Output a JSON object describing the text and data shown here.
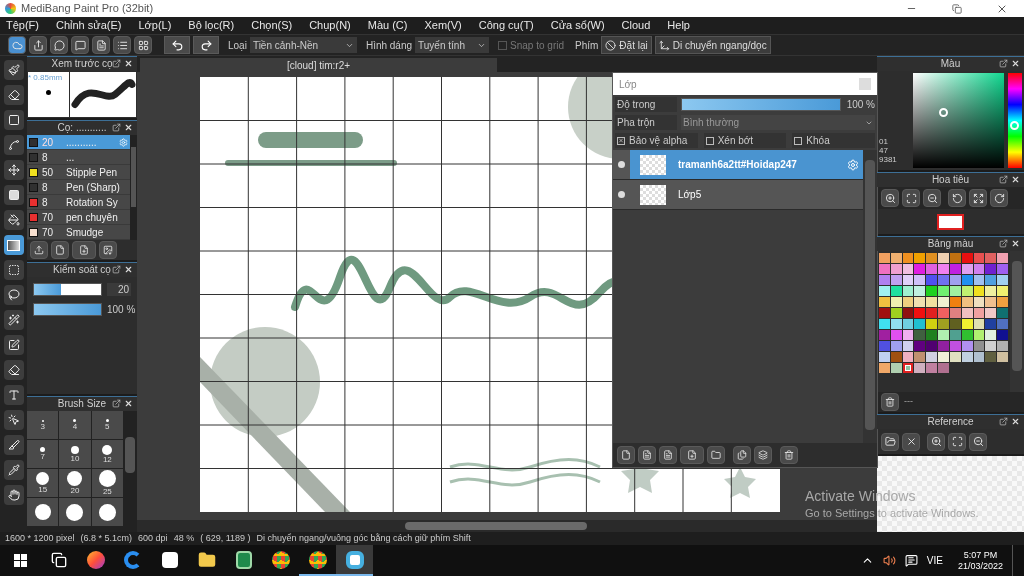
{
  "window": {
    "title": "MediBang Paint Pro (32bit)"
  },
  "menu": [
    "Tệp(F)",
    "Chỉnh sửa(E)",
    "Lớp(L)",
    "Bộ lọc(R)",
    "Chọn(S)",
    "Chụp(N)",
    "Màu (C)",
    "Xem(V)",
    "Công cụ(T)",
    "Cửa sổ(W)",
    "Cloud",
    "Help"
  ],
  "toolbar": {
    "buttons": [
      {
        "kind": "cloud",
        "selected": true
      },
      {
        "kind": "share",
        "selected": false
      },
      {
        "kind": "bubble",
        "selected": false
      },
      {
        "kind": "comment",
        "selected": false
      },
      {
        "kind": "page",
        "selected": false
      },
      {
        "kind": "list",
        "selected": false
      },
      {
        "kind": "grid",
        "selected": false
      }
    ],
    "type_label": "Loại",
    "type_value": "Tiền cảnh-Nền",
    "shape_label": "Hình dáng",
    "shape_value": "Tuyến tính",
    "snap": {
      "label": "Snap to grid",
      "checked": false,
      "disabled": true
    },
    "key_label": "Phím",
    "reset": "Đặt lại",
    "move": "Di chuyển ngang/dọc"
  },
  "tools": [
    {
      "kind": "brush",
      "selected": false
    },
    {
      "kind": "eraser",
      "selected": false
    },
    {
      "kind": "rect",
      "selected": false
    },
    {
      "kind": "polyline",
      "selected": false
    },
    {
      "kind": "move",
      "selected": false
    },
    {
      "kind": "fill-rect",
      "selected": false
    },
    {
      "kind": "bucket",
      "selected": false
    },
    {
      "kind": "gradient",
      "selected": true
    },
    {
      "kind": "select",
      "selected": false
    },
    {
      "kind": "lasso",
      "selected": false
    },
    {
      "kind": "wand",
      "selected": false
    },
    {
      "kind": "select-pen",
      "selected": false
    },
    {
      "kind": "select-eraser",
      "selected": false
    },
    {
      "kind": "text",
      "selected": false
    },
    {
      "kind": "operation",
      "selected": false
    },
    {
      "kind": "divide",
      "selected": false
    },
    {
      "kind": "eyedropper",
      "selected": false
    },
    {
      "kind": "hand",
      "selected": false
    }
  ],
  "brush_preview": {
    "title": "Xem trước cọ",
    "size": "* 0.85mm"
  },
  "brushes": {
    "title": "Cọ: ...........",
    "items": [
      {
        "size": "20",
        "name": "...........",
        "color": "#303030",
        "selected": true
      },
      {
        "size": "8",
        "name": "...",
        "color": "#303030",
        "selected": false
      },
      {
        "size": "50",
        "name": "Stipple Pen",
        "color": "#f0e020",
        "selected": false
      },
      {
        "size": "8",
        "name": "Pen (Sharp)",
        "color": "#303030",
        "selected": false
      },
      {
        "size": "8",
        "name": "Rotation Sy",
        "color": "#e83030",
        "selected": false
      },
      {
        "size": "70",
        "name": "pen chuyên",
        "color": "#e83030",
        "selected": false
      },
      {
        "size": "70",
        "name": "Smudge",
        "color": "#f8e0d0",
        "selected": false
      }
    ]
  },
  "brush_control": {
    "title": "Kiểm soát cọ",
    "size": {
      "level": 0.4,
      "reading": "20"
    },
    "opacity": {
      "level": 1,
      "reading": "100 %"
    }
  },
  "brush_size": {
    "title": "Brush Size",
    "items": [
      {
        "kind": "labeled",
        "label": "3"
      },
      {
        "kind": "labeled",
        "label": "4"
      },
      {
        "kind": "labeled",
        "label": "5"
      },
      {
        "kind": "labeled",
        "label": "7"
      },
      {
        "kind": "labeled",
        "label": "10"
      },
      {
        "kind": "labeled",
        "label": "12"
      },
      {
        "kind": "labeled",
        "label": "15"
      },
      {
        "kind": "labeled",
        "label": "20"
      },
      {
        "kind": "labeled",
        "label": "25"
      },
      {
        "kind": "unlabeled"
      },
      {
        "kind": "unlabeled"
      },
      {
        "kind": "unlabeled"
      }
    ]
  },
  "canvas": {
    "tab": "[cloud] tim:r2+"
  },
  "layers": {
    "title": "Lớp",
    "opacity_label": "Độ trong",
    "opacity": {
      "level": 1,
      "reading": "100 %"
    },
    "blend_label": "Pha trộn",
    "blend_value": "Bình thường",
    "options": [
      {
        "label": "Bảo vệ alpha",
        "checked": true
      },
      {
        "label": "Xén bớt",
        "checked": false
      },
      {
        "label": "Khóa",
        "checked": false
      }
    ],
    "items": [
      {
        "name": "tramanh6a2tt#Hoidap247",
        "selected": true
      },
      {
        "name": "Lớp5",
        "selected": false
      }
    ]
  },
  "color_panel": {
    "title": "Màu",
    "values": [
      "01",
      "47",
      "9381"
    ]
  },
  "navigator": {
    "title": "Hoa tiêu"
  },
  "palette": {
    "title": "Bảng màu",
    "footer": "---",
    "swatches": [
      {
        "color": "#f0a060",
        "selected": false
      },
      {
        "color": "#f0b070",
        "selected": false
      },
      {
        "color": "#f09020",
        "selected": false
      },
      {
        "color": "#f0a000",
        "selected": false
      },
      {
        "color": "#e09020",
        "selected": false
      },
      {
        "color": "#f0d0b0",
        "selected": false
      },
      {
        "color": "#c07010",
        "selected": false
      },
      {
        "color": "#e81010",
        "selected": false
      },
      {
        "color": "#e85050",
        "selected": false
      },
      {
        "color": "#e06060",
        "selected": false
      },
      {
        "color": "#f0a0b0",
        "selected": false
      },
      {
        "color": "#f070c0",
        "selected": false
      },
      {
        "color": "#f0a0d0",
        "selected": false
      },
      {
        "color": "#f0c0e0",
        "selected": false
      },
      {
        "color": "#e020e0",
        "selected": false
      },
      {
        "color": "#e060e0",
        "selected": false
      },
      {
        "color": "#f080f0",
        "selected": false
      },
      {
        "color": "#c020e0",
        "selected": false
      },
      {
        "color": "#e0a0f0",
        "selected": false
      },
      {
        "color": "#d080f0",
        "selected": false
      },
      {
        "color": "#7020d0",
        "selected": false
      },
      {
        "color": "#a060f0",
        "selected": false
      },
      {
        "color": "#b080f0",
        "selected": false
      },
      {
        "color": "#c0a0f0",
        "selected": false
      },
      {
        "color": "#e0d0f8",
        "selected": false
      },
      {
        "color": "#d0c0f8",
        "selected": false
      },
      {
        "color": "#5050f0",
        "selected": false
      },
      {
        "color": "#7070f0",
        "selected": false
      },
      {
        "color": "#a0a0f0",
        "selected": false
      },
      {
        "color": "#2090f0",
        "selected": false
      },
      {
        "color": "#a0c0f0",
        "selected": false
      },
      {
        "color": "#50a0e0",
        "selected": false
      },
      {
        "color": "#a0d0f0",
        "selected": false
      },
      {
        "color": "#a0f0f0",
        "selected": false
      },
      {
        "color": "#20e0a0",
        "selected": false
      },
      {
        "color": "#a0f0d0",
        "selected": false
      },
      {
        "color": "#c0f0e0",
        "selected": false
      },
      {
        "color": "#20d020",
        "selected": false
      },
      {
        "color": "#70f070",
        "selected": false
      },
      {
        "color": "#a0f0a0",
        "selected": false
      },
      {
        "color": "#c0f070",
        "selected": false
      },
      {
        "color": "#f0e020",
        "selected": false
      },
      {
        "color": "#f0f0a0",
        "selected": false
      },
      {
        "color": "#f0f070",
        "selected": false
      },
      {
        "color": "#f0c040",
        "selected": false
      },
      {
        "color": "#f0f0b0",
        "selected": false
      },
      {
        "color": "#f0d080",
        "selected": false
      },
      {
        "color": "#f0e0b0",
        "selected": false
      },
      {
        "color": "#f0e0a0",
        "selected": false
      },
      {
        "color": "#f0f0d0",
        "selected": false
      },
      {
        "color": "#f08010",
        "selected": false
      },
      {
        "color": "#f0c080",
        "selected": false
      },
      {
        "color": "#f0e0c0",
        "selected": false
      },
      {
        "color": "#f0c090",
        "selected": false
      },
      {
        "color": "#f0a040",
        "selected": false
      },
      {
        "color": "#a01010",
        "selected": false
      },
      {
        "color": "#a0d020",
        "selected": false
      },
      {
        "color": "#901010",
        "selected": false
      },
      {
        "color": "#f01010",
        "selected": false
      },
      {
        "color": "#e02020",
        "selected": false
      },
      {
        "color": "#f06060",
        "selected": false
      },
      {
        "color": "#e08080",
        "selected": false
      },
      {
        "color": "#f0c0c0",
        "selected": false
      },
      {
        "color": "#f0a0a0",
        "selected": false
      },
      {
        "color": "#f0c8c8",
        "selected": false
      },
      {
        "color": "#107070",
        "selected": false
      },
      {
        "color": "#40e0f0",
        "selected": false
      },
      {
        "color": "#90e0f0",
        "selected": false
      },
      {
        "color": "#70d0e0",
        "selected": false
      },
      {
        "color": "#20c0d0",
        "selected": false
      },
      {
        "color": "#d0d010",
        "selected": false
      },
      {
        "color": "#a0a020",
        "selected": false
      },
      {
        "color": "#606020",
        "selected": false
      },
      {
        "color": "#f0f030",
        "selected": false
      },
      {
        "color": "#e0e0b0",
        "selected": false
      },
      {
        "color": "#2040a0",
        "selected": false
      },
      {
        "color": "#5070c0",
        "selected": false
      },
      {
        "color": "#a020a0",
        "selected": false
      },
      {
        "color": "#e050f0",
        "selected": false
      },
      {
        "color": "#f0b0f0",
        "selected": false
      },
      {
        "color": "#406040",
        "selected": false
      },
      {
        "color": "#208020",
        "selected": false
      },
      {
        "color": "#b0f0b0",
        "selected": false
      },
      {
        "color": "#50a090",
        "selected": false
      },
      {
        "color": "#30c030",
        "selected": false
      },
      {
        "color": "#b0f070",
        "selected": false
      },
      {
        "color": "#e0f0e0",
        "selected": false
      },
      {
        "color": "#101090",
        "selected": false
      },
      {
        "color": "#5050e0",
        "selected": false
      },
      {
        "color": "#a0a0f0",
        "selected": false
      },
      {
        "color": "#d0d0f0",
        "selected": false
      },
      {
        "color": "#600080",
        "selected": false
      },
      {
        "color": "#500070",
        "selected": false
      },
      {
        "color": "#9020a0",
        "selected": false
      },
      {
        "color": "#c050e0",
        "selected": false
      },
      {
        "color": "#b090f0",
        "selected": false
      },
      {
        "color": "#909090",
        "selected": false
      },
      {
        "color": "#d0d0d0",
        "selected": false
      },
      {
        "color": "#b0b0b0",
        "selected": false
      },
      {
        "color": "#c0d0f0",
        "selected": false
      },
      {
        "color": "#a05010",
        "selected": false
      },
      {
        "color": "#f0b0c0",
        "selected": false
      },
      {
        "color": "#c09070",
        "selected": false
      },
      {
        "color": "#d0d0e0",
        "selected": false
      },
      {
        "color": "#f0f0d8",
        "selected": false
      },
      {
        "color": "#e0e0c0",
        "selected": false
      },
      {
        "color": "#c0d0e0",
        "selected": false
      },
      {
        "color": "#b0c0d0",
        "selected": false
      },
      {
        "color": "#606040",
        "selected": false
      },
      {
        "color": "#d0c0a0",
        "selected": false
      },
      {
        "color": "#f0a868",
        "selected": false
      },
      {
        "color": "#b0d0b0",
        "selected": false
      },
      {
        "color": "#90c0a0",
        "selected": true
      },
      {
        "color": "#d0b0c0",
        "selected": false
      },
      {
        "color": "#c080a0",
        "selected": false
      },
      {
        "color": "#b07090",
        "selected": false
      }
    ]
  },
  "reference": {
    "title": "Reference"
  },
  "activation": {
    "title": "Activate Windows",
    "hint": "Go to Settings to activate Windows."
  },
  "status_bar": [
    "1600 * 1200 pixel",
    "(6.8 * 5.1cm)",
    "600 dpi",
    "48 %",
    "( 629, 1189 )",
    "Di chuyển ngang/vuông góc bằng cách giữ phím Shift"
  ],
  "taskbar": {
    "apps": [
      {
        "kind": "taskview",
        "open": false,
        "selected": false
      },
      {
        "kind": "firefox",
        "open": false,
        "selected": false
      },
      {
        "kind": "edge",
        "open": false,
        "selected": false
      },
      {
        "kind": "store",
        "open": false,
        "selected": false
      },
      {
        "kind": "explorer",
        "open": false,
        "selected": false
      },
      {
        "kind": "excel",
        "open": false,
        "selected": false
      },
      {
        "kind": "chrome",
        "open": false,
        "selected": false
      },
      {
        "kind": "chrome",
        "open": true,
        "selected": false
      },
      {
        "kind": "medibang",
        "open": true,
        "selected": true
      }
    ],
    "language": "VIE",
    "time": "5:07 PM",
    "date": "21/03/2022"
  }
}
